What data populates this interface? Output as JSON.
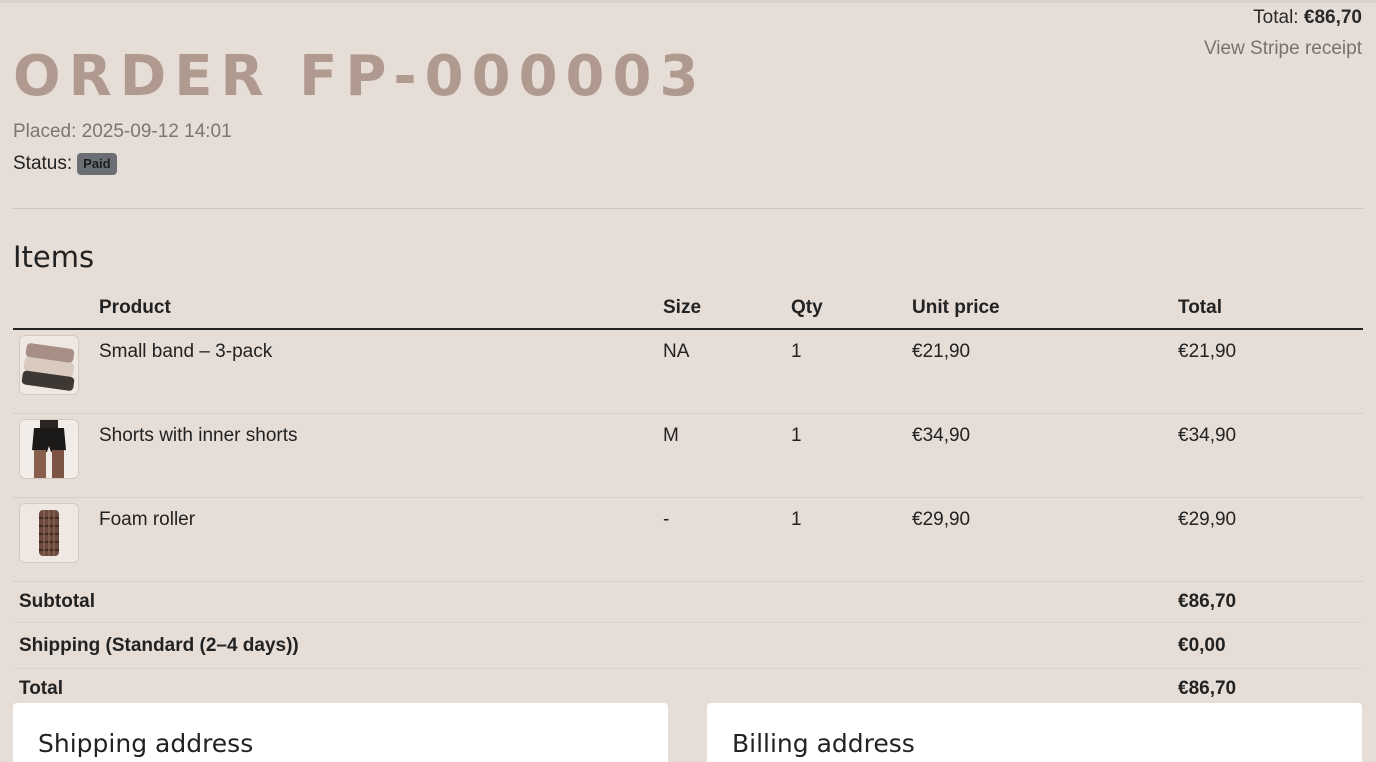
{
  "header": {
    "total_label": "Total:",
    "total_value": "€86,70",
    "receipt_link": "View Stripe receipt"
  },
  "order": {
    "title": "ORDER FP-000003",
    "placed": "Placed: 2025-09-12 14:01",
    "status_label": "Status:",
    "status_badge": "Paid"
  },
  "items_section": {
    "heading": "Items",
    "columns": [
      "",
      "Product",
      "Size",
      "Qty",
      "Unit price",
      "Total"
    ],
    "rows": [
      {
        "product": "Small band – 3-pack",
        "size": "NA",
        "qty": "1",
        "unit_price": "€21,90",
        "total": "€21,90",
        "thumb_icon": "resistance-bands-image"
      },
      {
        "product": "Shorts with inner shorts",
        "size": "M",
        "qty": "1",
        "unit_price": "€34,90",
        "total": "€34,90",
        "thumb_icon": "shorts-image"
      },
      {
        "product": "Foam roller",
        "size": "-",
        "qty": "1",
        "unit_price": "€29,90",
        "total": "€29,90",
        "thumb_icon": "foam-roller-image"
      }
    ],
    "summary": [
      {
        "label": "Subtotal",
        "value": "€86,70"
      },
      {
        "label": "Shipping (Standard (2–4 days))",
        "value": "€0,00"
      },
      {
        "label": "Total",
        "value": "€86,70"
      }
    ]
  },
  "cards": {
    "shipping_title": "Shipping address",
    "billing_title": "Billing address"
  },
  "colors": {
    "background": "#e6ddd7",
    "title": "#b09a90",
    "badge": "#6b6f75",
    "card": "#ffffff"
  }
}
